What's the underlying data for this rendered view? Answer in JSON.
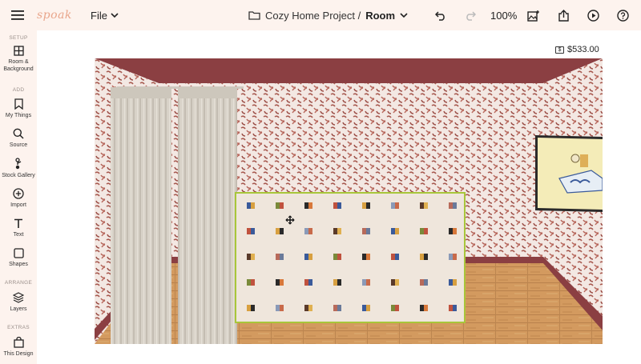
{
  "app": {
    "logo": "spoak",
    "file_menu": "File",
    "project_name": "Cozy Home Project /",
    "room_name": "Room",
    "zoom": "100%"
  },
  "sidebar": {
    "sections": {
      "setup": "SETUP",
      "add": "ADD",
      "arrange": "ARRANGE",
      "extras": "EXTRAS"
    },
    "tools": {
      "room_background": "Room &\nBackground",
      "my_things": "My Things",
      "source": "Source",
      "stock_gallery": "Stock Gallery",
      "import": "Import",
      "text": "Text",
      "shapes": "Shapes",
      "layers": "Layers",
      "this_design": "This Design"
    }
  },
  "canvas": {
    "price": "$533.00"
  },
  "colors": {
    "chrome_bg": "#fdf3ee",
    "wall_accent": "#8b3f42",
    "floor": "#c98b52",
    "selection": "#a8c63a"
  }
}
